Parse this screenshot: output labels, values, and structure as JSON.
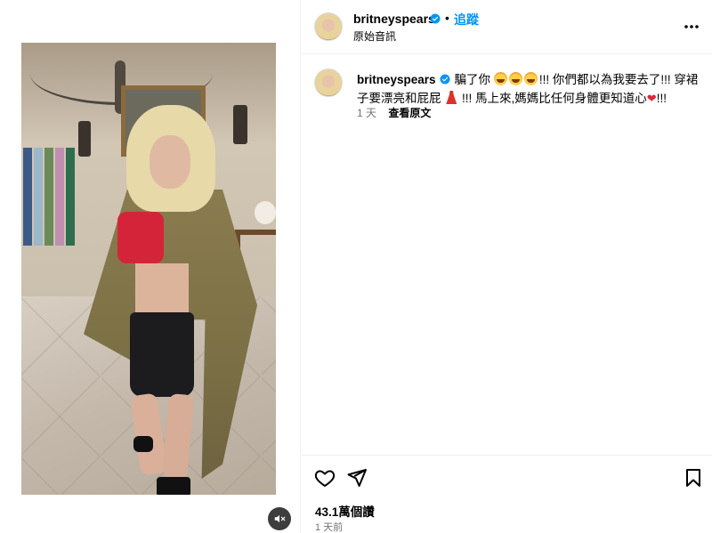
{
  "post": {
    "username": "britneyspears",
    "follow_label": "追蹤",
    "separator": "•",
    "audio_label": "原始音訊"
  },
  "caption": {
    "username": "britneyspears",
    "text_1": "騙了你 ",
    "text_2": "!!! 你們都以為我要去了!!! 穿裙子要漂亮和屁屁 ",
    "text_3": " !!! 馬上來,媽媽比任何身體更知道心",
    "heart": "❤",
    "text_4": "!!!",
    "age": "1 天",
    "see_translation": "查看原文"
  },
  "stats": {
    "likes": "43.1萬個讚",
    "posted": "1 天前"
  },
  "icons": {
    "verified": "verified-badge-icon",
    "more": "more-options-icon",
    "mute": "muted-speaker-icon",
    "like": "heart-icon",
    "share": "paper-plane-icon",
    "save": "bookmark-icon"
  },
  "colors": {
    "follow": "#0095f6",
    "verified": "#0095f6",
    "secondary_text": "#737373"
  }
}
